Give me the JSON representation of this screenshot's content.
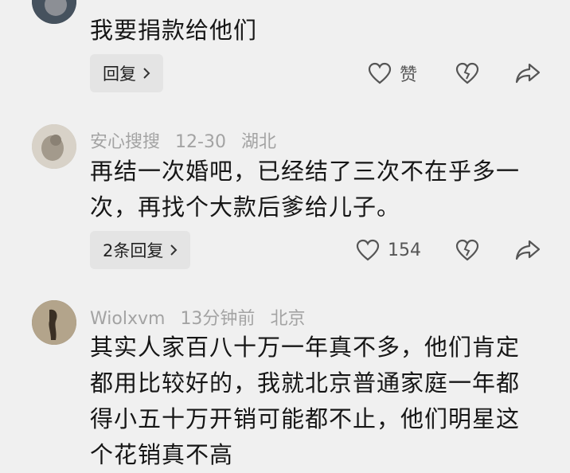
{
  "comments": [
    {
      "text": "我要捐款给他们",
      "reply_label": "回复",
      "like_label": "赞"
    },
    {
      "user": "安心搜搜",
      "date": "12-30",
      "location": "湖北",
      "text": "再结一次婚吧，已经结了三次不在乎多一次，再找个大款后爹给儿子。",
      "reply_label": "2条回复",
      "like_label": "154"
    },
    {
      "user": "Wiolxvm",
      "date": "13分钟前",
      "location": "北京",
      "text": "其实人家百八十万一年真不多，他们肯定都用比较好的，我就北京普通家庭一年都得小五十万开销可能都不止，他们明星这个花销真不高"
    }
  ],
  "icons": {
    "like": "heart-outline-icon",
    "dislike": "broken-heart-icon",
    "share": "share-arrow-icon",
    "chevron": "chevron-right-icon"
  }
}
